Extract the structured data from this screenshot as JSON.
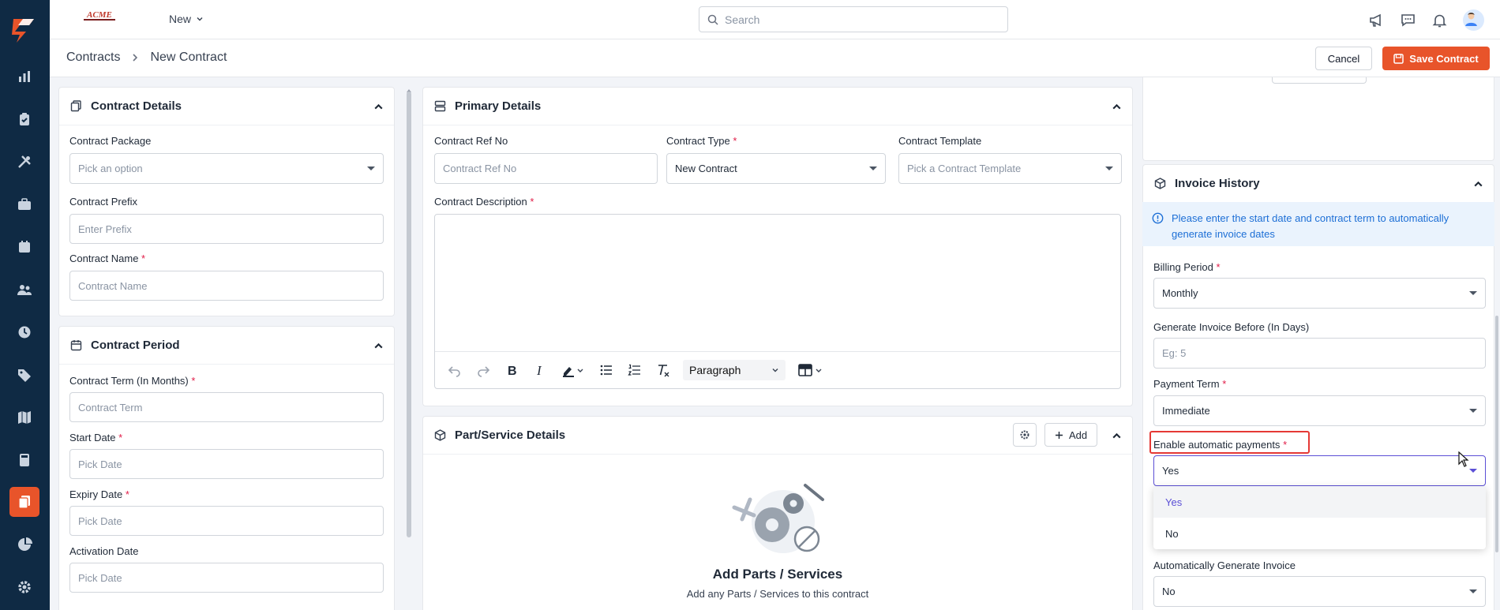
{
  "topbar": {
    "brand": "ACME",
    "new_label": "New",
    "search_placeholder": "Search"
  },
  "breadcrumb": {
    "root": "Contracts",
    "current": "New Contract"
  },
  "actions": {
    "cancel_label": "Cancel",
    "save_label": "Save Contract"
  },
  "contract_details": {
    "title": "Contract Details",
    "package_label": "Contract Package",
    "package_placeholder": "Pick an option",
    "prefix_label": "Contract Prefix",
    "prefix_placeholder": "Enter Prefix",
    "name_label": "Contract Name",
    "name_placeholder": "Contract Name",
    "required_mark": "*"
  },
  "contract_period": {
    "title": "Contract Period",
    "term_label": "Contract Term (In Months)",
    "term_placeholder": "Contract Term",
    "start_label": "Start Date",
    "start_placeholder": "Pick Date",
    "expiry_label": "Expiry Date",
    "expiry_placeholder": "Pick Date",
    "activation_label": "Activation Date",
    "activation_placeholder": "Pick Date"
  },
  "primary_details": {
    "title": "Primary Details",
    "ref_label": "Contract Ref No",
    "ref_placeholder": "Contract Ref No",
    "type_label": "Contract Type",
    "type_value": "New Contract",
    "template_label": "Contract Template",
    "template_placeholder": "Pick a Contract Template",
    "description_label": "Contract Description",
    "paragraph_style": "Paragraph"
  },
  "parts_services": {
    "title": "Part/Service Details",
    "add_label": "Add",
    "empty_title": "Add Parts / Services",
    "empty_subtitle": "Add any Parts / Services to this contract"
  },
  "invoice_history": {
    "title": "Invoice History",
    "info_text": "Please enter the start date and contract term to automatically generate invoice dates",
    "billing_label": "Billing Period",
    "billing_value": "Monthly",
    "generate_before_label": "Generate Invoice Before (In Days)",
    "generate_before_placeholder": "Eg: 5",
    "payment_term_label": "Payment Term",
    "payment_term_value": "Immediate",
    "auto_pay_label": "Enable automatic payments",
    "auto_pay_value": "Yes",
    "auto_pay_options": [
      "Yes",
      "No"
    ],
    "auto_generate_label": "Automatically Generate Invoice",
    "auto_generate_value": "No"
  },
  "colors": {
    "sidebar": "#0f2a44",
    "accent": "#e8542a",
    "focus": "#5b4fd6",
    "info": "#1d6fd6"
  }
}
